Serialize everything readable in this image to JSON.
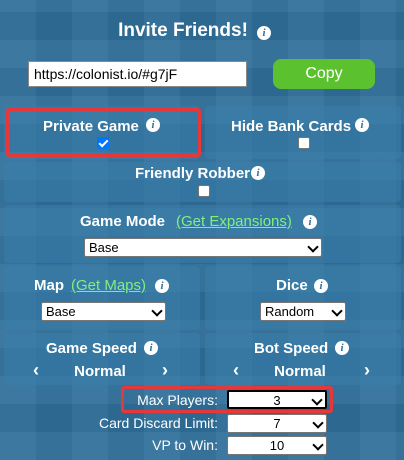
{
  "header": {
    "title": "Invite Friends!"
  },
  "invite": {
    "url": "https://colonist.io/#g7jF",
    "copy_label": "Copy"
  },
  "options": {
    "private_game": {
      "label": "Private Game",
      "checked": true
    },
    "hide_bank_cards": {
      "label": "Hide Bank Cards",
      "checked": false
    },
    "friendly_robber": {
      "label": "Friendly Robber",
      "checked": false
    }
  },
  "game_mode": {
    "label": "Game Mode",
    "link": "(Get Expansions)",
    "value": "Base"
  },
  "map": {
    "label": "Map",
    "link": "(Get Maps)",
    "value": "Base"
  },
  "dice": {
    "label": "Dice",
    "value": "Random"
  },
  "game_speed": {
    "label": "Game Speed",
    "value": "Normal"
  },
  "bot_speed": {
    "label": "Bot Speed",
    "value": "Normal"
  },
  "settings": {
    "max_players": {
      "label": "Max Players:",
      "value": "3"
    },
    "card_discard": {
      "label": "Card Discard Limit:",
      "value": "7"
    },
    "vp_to_win": {
      "label": "VP to Win:",
      "value": "10"
    }
  },
  "icons": {
    "info": "info-icon",
    "left": "chevron-left-icon",
    "right": "chevron-right-icon"
  },
  "colors": {
    "background": "#2f6f9a",
    "copy_button": "#5cc12e",
    "link": "#7ef07e",
    "highlight": "#e4383a",
    "checkbox_checked": "#0075ff"
  }
}
